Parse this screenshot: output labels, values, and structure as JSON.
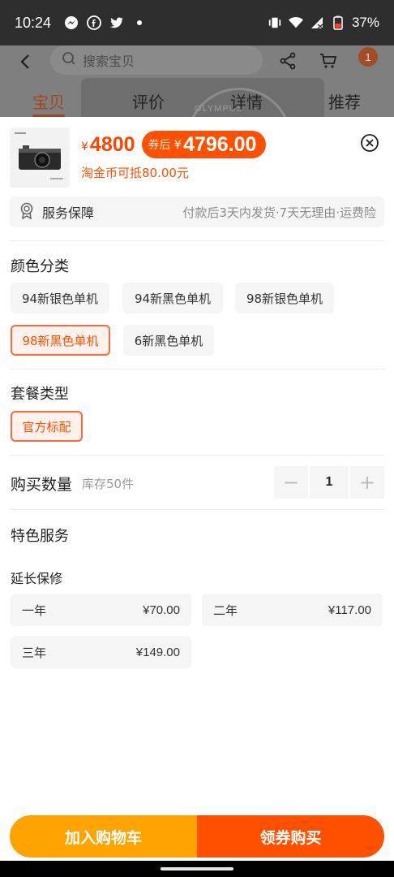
{
  "status_bar": {
    "time": "10:24",
    "battery": "37%",
    "notification_icons": [
      "messenger-icon",
      "facebook-icon",
      "twitter-icon",
      "dot-icon"
    ]
  },
  "header": {
    "search_placeholder": "搜索宝贝",
    "cart_badge": "1",
    "tabs": [
      {
        "label": "宝贝",
        "active": true
      },
      {
        "label": "评价",
        "active": false
      },
      {
        "label": "详情",
        "active": false
      },
      {
        "label": "推荐",
        "active": false
      }
    ],
    "background_brand": "OLYMPUS"
  },
  "sku_panel": {
    "price_currency": "¥",
    "price": "4800",
    "coupon_label": "券后",
    "coupon_currency": "¥",
    "coupon_price": "4796.00",
    "coin_text": "淘金币可抵80.00元",
    "service": {
      "title": "服务保障",
      "desc": "付款后3天内发货·7天无理由·运费险"
    },
    "color_section": {
      "title": "颜色分类",
      "options": [
        "94新银色单机",
        "94新黑色单机",
        "98新银色单机",
        "98新黑色单机",
        "6新黑色单机"
      ],
      "selected": "98新黑色单机"
    },
    "package_section": {
      "title": "套餐类型",
      "options": [
        "官方标配"
      ],
      "selected": "官方标配"
    },
    "quantity": {
      "label": "购买数量",
      "stock": "库存50件",
      "value": "1",
      "minus": "−",
      "plus": "+"
    },
    "special_service": {
      "title": "特色服务",
      "subtitle": "延长保修",
      "options": [
        {
          "label": "一年",
          "price": "¥70.00"
        },
        {
          "label": "二年",
          "price": "¥117.00"
        },
        {
          "label": "三年",
          "price": "¥149.00"
        }
      ]
    },
    "buttons": {
      "add_cart": "加入购物车",
      "buy": "领券购买"
    }
  },
  "colors": {
    "accent": "#ff5000",
    "cart_button": "#ffa300",
    "status_bar": "#2e2e2e"
  }
}
